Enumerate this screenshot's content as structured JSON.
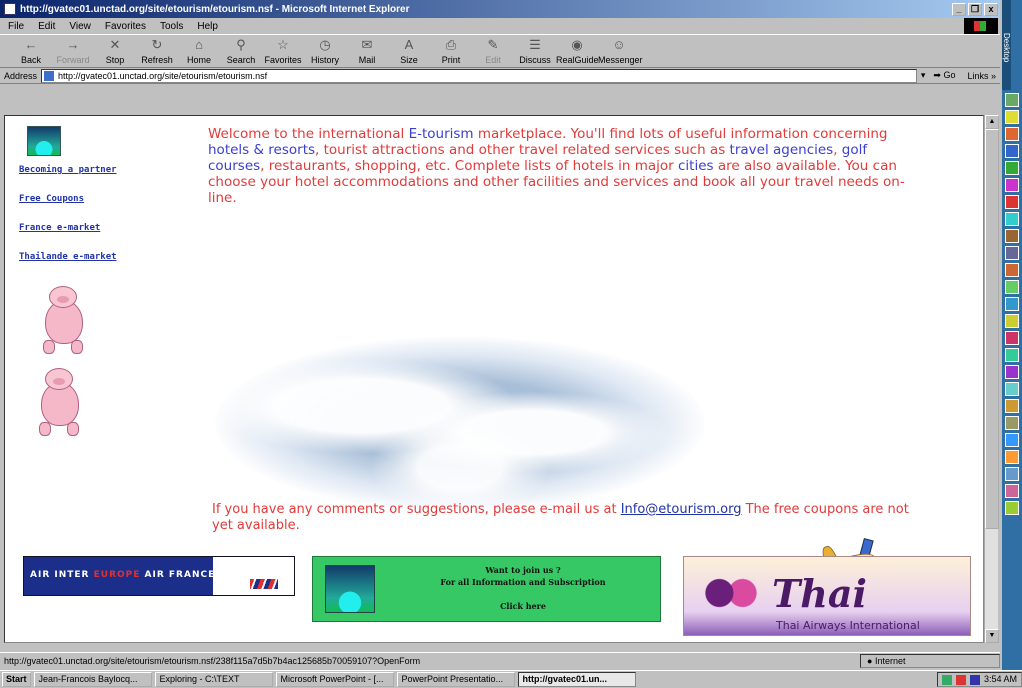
{
  "window": {
    "title": "http://gvatec01.unctad.org/site/etourism/etourism.nsf - Microsoft Internet Explorer",
    "controls": [
      "_",
      "❐",
      "x"
    ]
  },
  "menu": [
    "File",
    "Edit",
    "View",
    "Favorites",
    "Tools",
    "Help"
  ],
  "toolbar": [
    {
      "label": "Back",
      "icon": "back-arrow-icon",
      "glyph": "←",
      "disabled": false
    },
    {
      "label": "Forward",
      "icon": "forward-arrow-icon",
      "glyph": "→",
      "disabled": true
    },
    {
      "label": "Stop",
      "icon": "stop-icon",
      "glyph": "✕",
      "disabled": false
    },
    {
      "label": "Refresh",
      "icon": "refresh-icon",
      "glyph": "↻",
      "disabled": false
    },
    {
      "label": "Home",
      "icon": "home-icon",
      "glyph": "⌂",
      "disabled": false
    },
    {
      "label": "Search",
      "icon": "search-icon",
      "glyph": "⚲",
      "disabled": false
    },
    {
      "label": "Favorites",
      "icon": "favorites-icon",
      "glyph": "☆",
      "disabled": false
    },
    {
      "label": "History",
      "icon": "history-icon",
      "glyph": "◷",
      "disabled": false
    },
    {
      "label": "Mail",
      "icon": "mail-icon",
      "glyph": "✉",
      "disabled": false
    },
    {
      "label": "Size",
      "icon": "size-icon",
      "glyph": "A",
      "disabled": false
    },
    {
      "label": "Print",
      "icon": "print-icon",
      "glyph": "⎙",
      "disabled": false
    },
    {
      "label": "Edit",
      "icon": "edit-icon",
      "glyph": "✎",
      "disabled": true
    },
    {
      "label": "Discuss",
      "icon": "discuss-icon",
      "glyph": "☰",
      "disabled": false
    },
    {
      "label": "RealGuide",
      "icon": "realguide-icon",
      "glyph": "◉",
      "disabled": false
    },
    {
      "label": "Messenger",
      "icon": "messenger-icon",
      "glyph": "☺",
      "disabled": false
    }
  ],
  "address": {
    "label": "Address",
    "url": "http://gvatec01.unctad.org/site/etourism/etourism.nsf",
    "go_label": "Go",
    "links_label": "Links »"
  },
  "sidebar": {
    "links": [
      "Becoming a partner",
      "Free Coupons",
      "France e-market",
      "Thailande e-market"
    ]
  },
  "content": {
    "welcome_parts": [
      {
        "text": "Welcome to the international ",
        "hl": false
      },
      {
        "text": "E-tourism",
        "hl": true
      },
      {
        "text": " marketplace. You'll find lots of useful information concerning ",
        "hl": false
      },
      {
        "text": "hotels & resorts",
        "hl": true
      },
      {
        "text": ", tourist attractions and other travel related services such as ",
        "hl": false
      },
      {
        "text": "travel agencies",
        "hl": true
      },
      {
        "text": ", ",
        "hl": false
      },
      {
        "text": "golf courses",
        "hl": true
      },
      {
        "text": ", restaurants, shopping, etc. Complete lists of hotels in major ",
        "hl": false
      },
      {
        "text": "cities",
        "hl": true
      },
      {
        "text": " are also available. You can choose your hotel accommodations and other facilities and services and book all your travel needs on-line.",
        "hl": false
      }
    ],
    "comments_before": "If you have any comments or suggestions, please e-mail us at ",
    "comments_email": "Info@etourism.org",
    "comments_after": " The free coupons are not yet available."
  },
  "banners": {
    "airfrance_part1": "AIR INTER ",
    "airfrance_part2": "EUROPE",
    "airfrance_part3": " AIR FRANCE",
    "join_line1": "Want to join us ?",
    "join_line2": "For all Information and Subscription",
    "join_line3": "Click here",
    "thai_word": "Thai",
    "thai_sub": "Thai Airways International"
  },
  "status": {
    "text": "http://gvatec01.unctad.org/site/etourism/etourism.nsf/238f115a7d5b7b4ac125685b70059107?OpenForm",
    "zone": "Internet"
  },
  "taskbar": {
    "start": "Start",
    "tasks": [
      {
        "label": "Jean-Francois Baylocq...",
        "active": false
      },
      {
        "label": "Exploring - C:\\TEXT",
        "active": false
      },
      {
        "label": "Microsoft PowerPoint - [...",
        "active": false
      },
      {
        "label": "PowerPoint Presentatio...",
        "active": false
      },
      {
        "label": "http://gvatec01.un...",
        "active": true
      }
    ],
    "clock": "3:54 AM"
  },
  "officebar": {
    "label": "Desktop"
  },
  "colors": {
    "text_red": "#e23a3a",
    "link_blue": "#2233aa",
    "highlight_blue": "#3a3fd0"
  }
}
